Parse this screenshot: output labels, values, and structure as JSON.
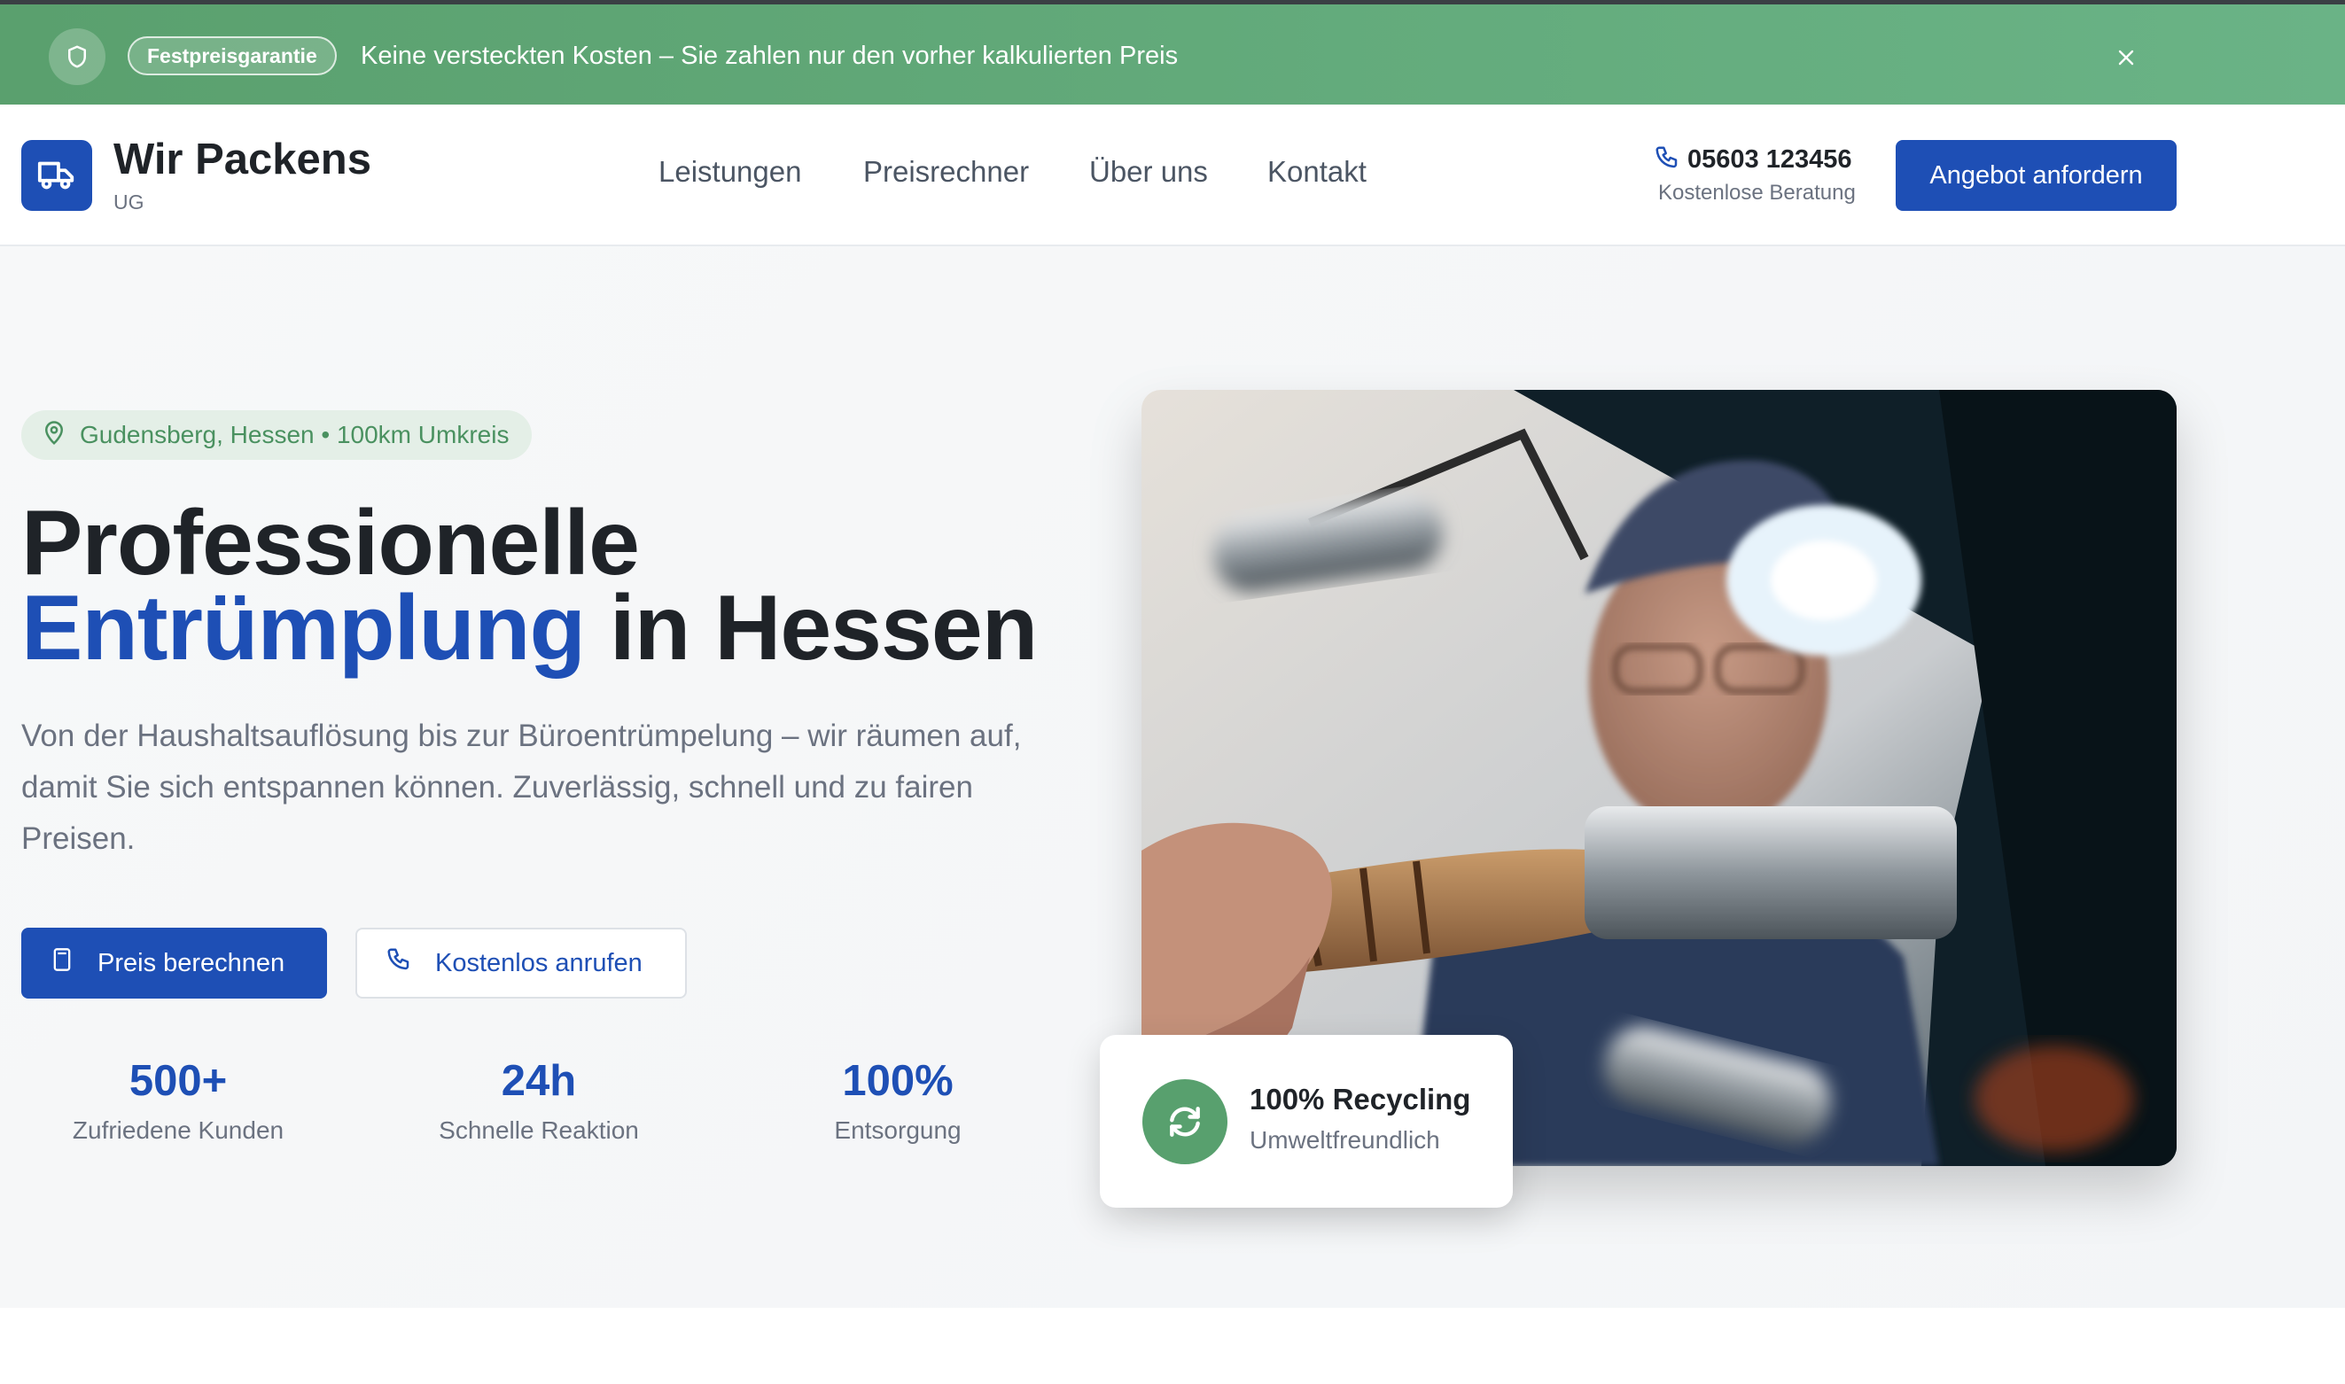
{
  "banner": {
    "badge": "Festpreisgarantie",
    "text": "Keine versteckten Kosten – Sie zahlen nur den vorher kalkulierten Preis",
    "icon": "shield-icon",
    "close_icon": "close-icon",
    "bg_color": "#5aa06e"
  },
  "header": {
    "brand": "Wir Packens",
    "brand_sub": "UG",
    "logo_icon": "truck-icon",
    "nav": [
      {
        "label": "Leistungen"
      },
      {
        "label": "Preisrechner"
      },
      {
        "label": "Über uns"
      },
      {
        "label": "Kontakt"
      }
    ],
    "phone": "05603 123456",
    "phone_sub": "Kostenlose Beratung",
    "cta": "Angebot anfordern"
  },
  "hero": {
    "location": "Gudensberg, Hessen • 100km Umkreis",
    "headline_line1": "Professionelle",
    "headline_accent": "Entrümplung",
    "headline_rest": " in Hessen",
    "lead": "Von der Haushaltsauflösung bis zur Büroentrümpelung – wir räumen auf, damit Sie sich entspannen können. Zuverlässig, schnell und zu fairen Preisen.",
    "btn_primary": "Preis berechnen",
    "btn_secondary": "Kostenlos anrufen",
    "stats": [
      {
        "value": "500+",
        "label": "Zufriedene Kunden"
      },
      {
        "value": "24h",
        "label": "Schnelle Reaktion"
      },
      {
        "value": "100%",
        "label": "Entsorgung"
      }
    ],
    "card_title": "100% Recycling",
    "card_sub": "Umweltfreundlich"
  },
  "colors": {
    "brand_blue": "#1e4fb5",
    "green": "#58a06e"
  }
}
